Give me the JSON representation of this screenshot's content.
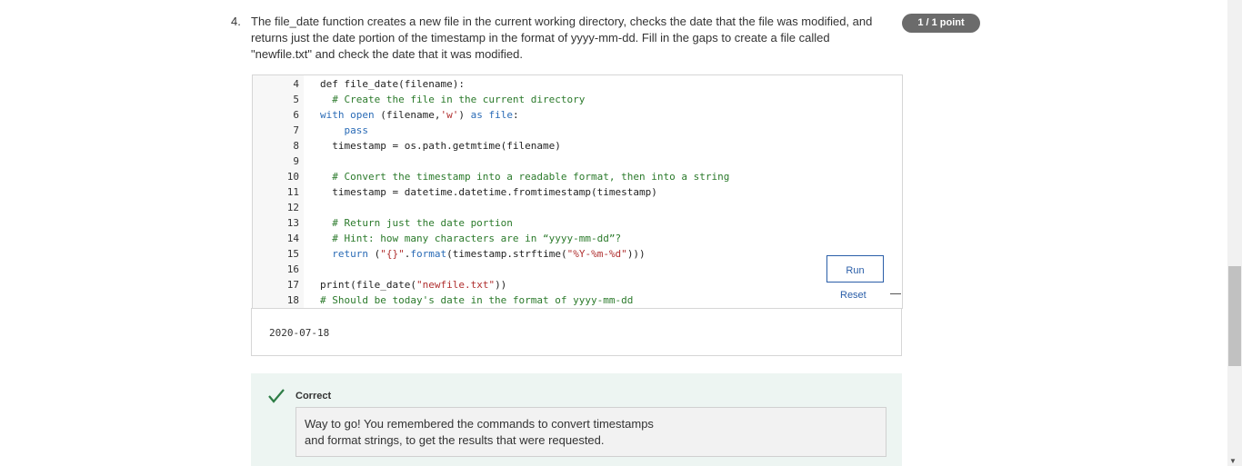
{
  "question": {
    "number": "4.",
    "text": "The file_date function creates a new file in the current working directory, checks the date that the file was modified, and returns just the date portion of the timestamp in the format of yyyy-mm-dd. Fill in the gaps to create a file called \"newfile.txt\" and check the date that it was modified.",
    "score": "1 / 1 point"
  },
  "code_lines": [
    {
      "num": "4",
      "text": "def file_date(filename):",
      "kind": "plain"
    },
    {
      "num": "5",
      "text": "  # Create the file in the current directory",
      "kind": "comment"
    },
    {
      "num": "6",
      "text": "  with open (filename,'w') as file:",
      "kind": "with"
    },
    {
      "num": "7",
      "text": "    pass",
      "kind": "kw"
    },
    {
      "num": "8",
      "text": "  timestamp = os.path.getmtime(filename)",
      "kind": "plain"
    },
    {
      "num": "9",
      "text": "",
      "kind": "plain"
    },
    {
      "num": "10",
      "text": "  # Convert the timestamp into a readable format, then into a string",
      "kind": "comment"
    },
    {
      "num": "11",
      "text": "  timestamp = datetime.datetime.fromtimestamp(timestamp)",
      "kind": "plain"
    },
    {
      "num": "12",
      "text": "",
      "kind": "plain"
    },
    {
      "num": "13",
      "text": "  # Return just the date portion",
      "kind": "comment"
    },
    {
      "num": "14",
      "text": "  # Hint: how many characters are in “yyyy-mm-dd”?",
      "kind": "comment"
    },
    {
      "num": "15",
      "text": "  return (\"{}\".format(timestamp.strftime(\"%Y-%m-%d\")))",
      "kind": "return"
    },
    {
      "num": "16",
      "text": "",
      "kind": "plain"
    },
    {
      "num": "17",
      "text": "print(file_date(\"newfile.txt\"))",
      "kind": "print"
    },
    {
      "num": "18",
      "text": "# Should be today's date in the format of yyyy-mm-dd",
      "kind": "comment"
    }
  ],
  "editor": {
    "run_label": "Run",
    "reset_label": "Reset"
  },
  "output": {
    "text": "2020-07-18"
  },
  "feedback": {
    "status": "Correct",
    "message_line1": "Way to go! You remembered the commands to convert timestamps",
    "message_line2": "and format strings, to get the results that were requested."
  },
  "colors": {
    "accent": "#2a5ea8",
    "success": "#2e7d46",
    "keyword": "#2a6bb6",
    "comment": "#2b7a2b",
    "string": "#b03030"
  }
}
